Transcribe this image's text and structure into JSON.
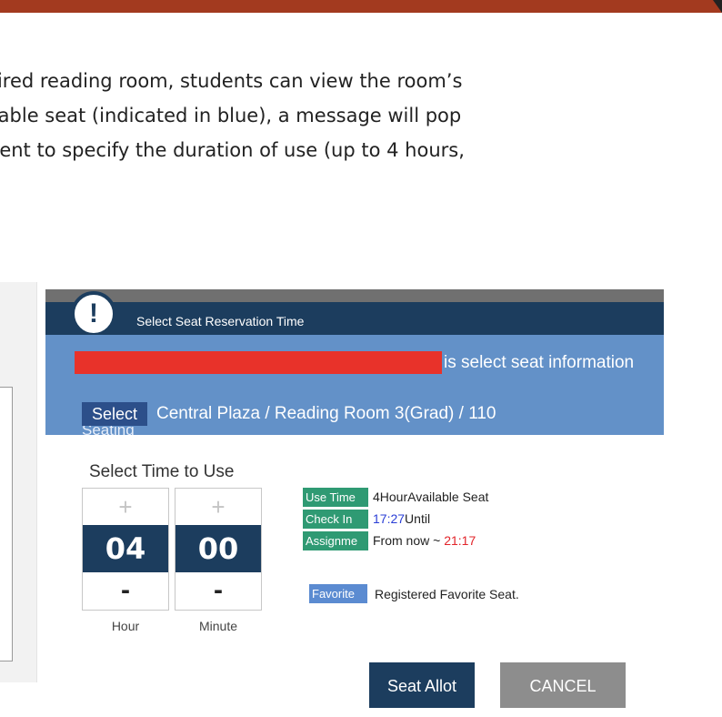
{
  "paragraph": {
    "line1": "sired reading room, students can view the room’s",
    "line2": "ilable seat (indicated in blue), a message will pop",
    "line3": "dent to specify the duration of use (up to 4 hours,"
  },
  "dialog": {
    "title": "Select Seat Reservation Time",
    "alert_icon": "!",
    "info_text": "is select seat information",
    "select_tag": "Select",
    "location": "Central Plaza / Reading Room 3(Grad) / 110",
    "seating_cut": "Seating",
    "select_time_title": "Select Time to Use",
    "hour": {
      "plus": "+",
      "value": "04",
      "minus": "-",
      "label": "Hour"
    },
    "minute": {
      "plus": "+",
      "value": "00",
      "minus": "-",
      "label": "Minute"
    },
    "rows": {
      "use_time": {
        "tag": "Use Time",
        "text": "4HourAvailable Seat"
      },
      "check_in": {
        "tag": "Check In",
        "time": "17:27",
        "text": "Until"
      },
      "assignment": {
        "tag": "Assignme",
        "prefix": "From now ~ ",
        "time": "21:17"
      },
      "favorite": {
        "tag": "Favorite",
        "text": "Registered Favorite Seat."
      }
    },
    "buttons": {
      "allot": "Seat Allot",
      "cancel": "CANCEL"
    }
  },
  "colors": {
    "header": "#1c3d5e",
    "info_band": "#6391c8",
    "redaction": "#e8322a",
    "tag_green": "#2f9a73",
    "tag_blue": "#5b8bd1",
    "check_in_time": "#2b3fd6",
    "assign_time": "#e2242a",
    "cancel_button": "#8d8d8d",
    "top_bar": "#a33a1f"
  }
}
